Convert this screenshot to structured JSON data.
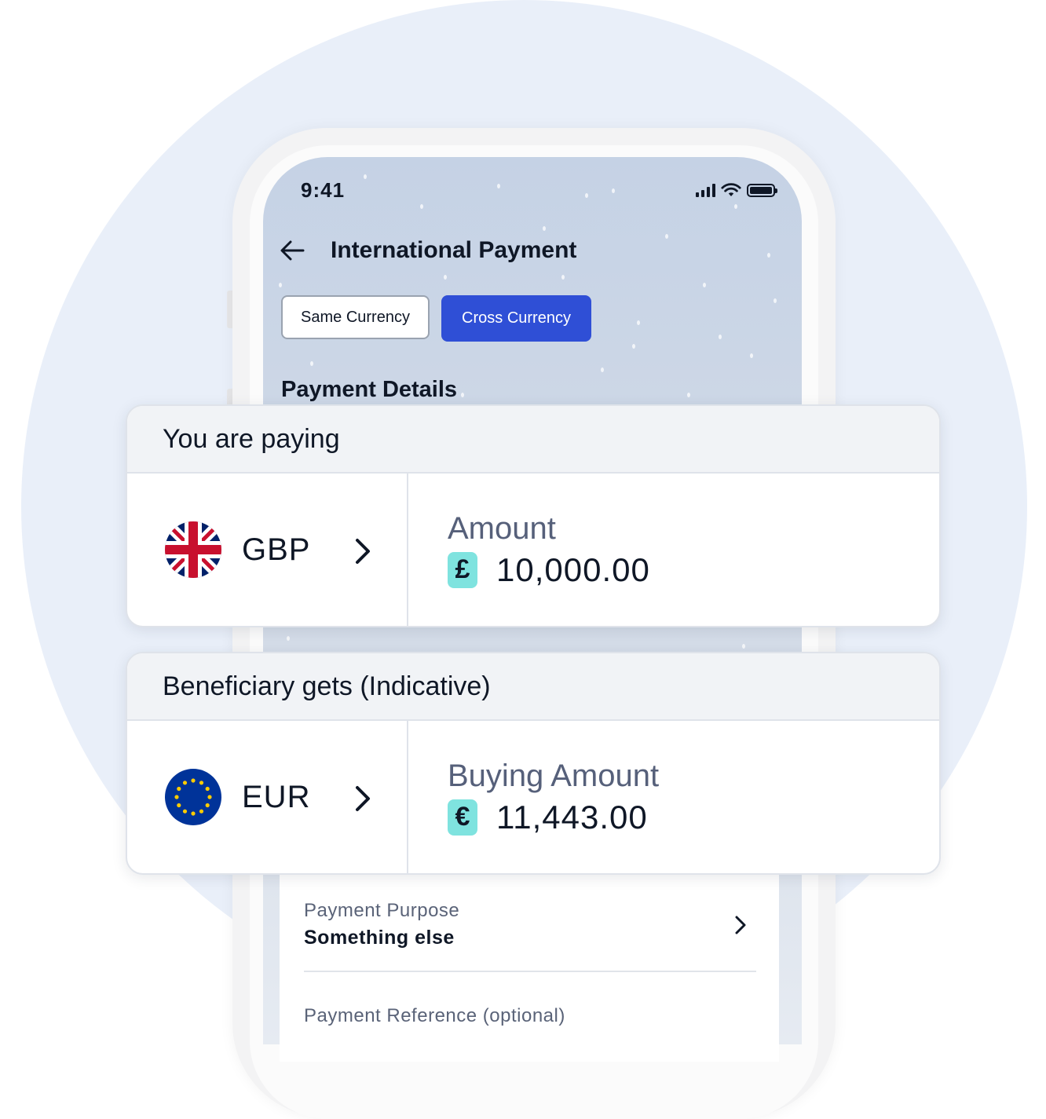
{
  "status_bar": {
    "time": "9:41"
  },
  "header": {
    "title": "International Payment"
  },
  "segmented": {
    "same_label": "Same Currency",
    "cross_label": "Cross Currency",
    "selected": "Cross Currency"
  },
  "section": {
    "title": "Payment Details"
  },
  "paying": {
    "heading": "You are paying",
    "currency": "GBP",
    "amount_label": "Amount",
    "symbol": "£",
    "amount": "10,000.00"
  },
  "beneficiary": {
    "heading": "Beneficiary gets (Indicative)",
    "currency": "EUR",
    "amount_label": "Buying Amount",
    "symbol": "€",
    "amount": "11,443.00"
  },
  "purpose": {
    "label": "Payment Purpose",
    "value": "Something else"
  },
  "reference": {
    "label": "Payment Reference (optional)"
  },
  "colors": {
    "accent": "#2f4fd6",
    "symbol_badge": "#7fe3df",
    "background_circle": "#e9eff9"
  }
}
